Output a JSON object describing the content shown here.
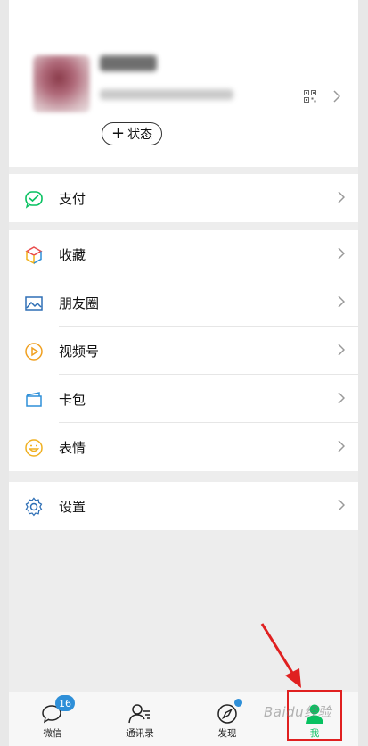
{
  "profile": {
    "status_plus": "+",
    "status_label": "状态"
  },
  "menu": {
    "pay": "支付",
    "favorites": "收藏",
    "moments": "朋友圈",
    "channels": "视频号",
    "cards": "卡包",
    "stickers": "表情",
    "settings": "设置"
  },
  "tabbar": {
    "chats": {
      "label": "微信",
      "badge": "16"
    },
    "contacts": {
      "label": "通讯录"
    },
    "discover": {
      "label": "发现"
    },
    "me": {
      "label": "我"
    }
  },
  "watermark": "Baidu经验",
  "colors": {
    "accent_green": "#07c160",
    "badge_blue": "#2e8fd8",
    "highlight_red": "#e02020"
  }
}
